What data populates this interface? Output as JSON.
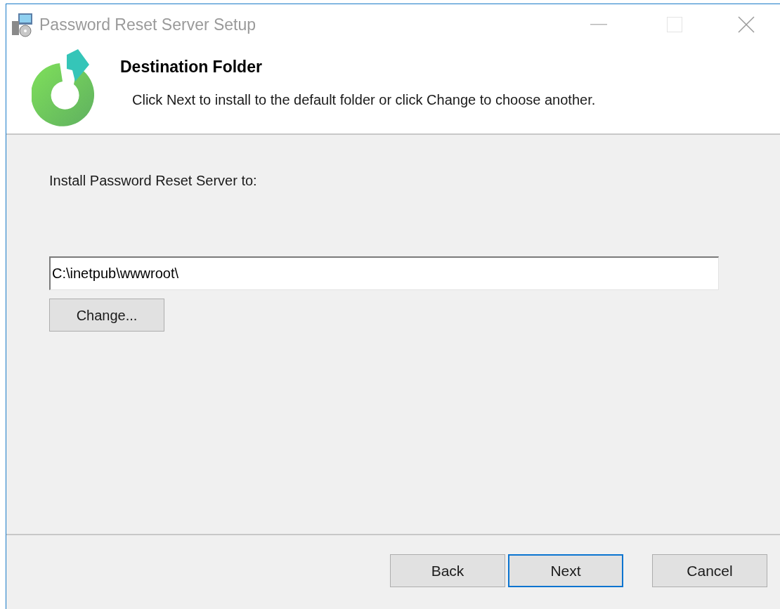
{
  "window": {
    "title": "Password Reset Server Setup"
  },
  "header": {
    "title": "Destination Folder",
    "description": "Click Next to install to the default folder or click Change to choose another."
  },
  "body": {
    "label": "Install Password Reset Server to:",
    "path": {
      "value": "C:\\inetpub\\wwwroot\\"
    },
    "change_button": "Change..."
  },
  "buttons": [
    {
      "label": "Back",
      "focused": false
    },
    {
      "label": "Next",
      "focused": true
    },
    {
      "label": "Cancel",
      "focused": false
    }
  ]
}
